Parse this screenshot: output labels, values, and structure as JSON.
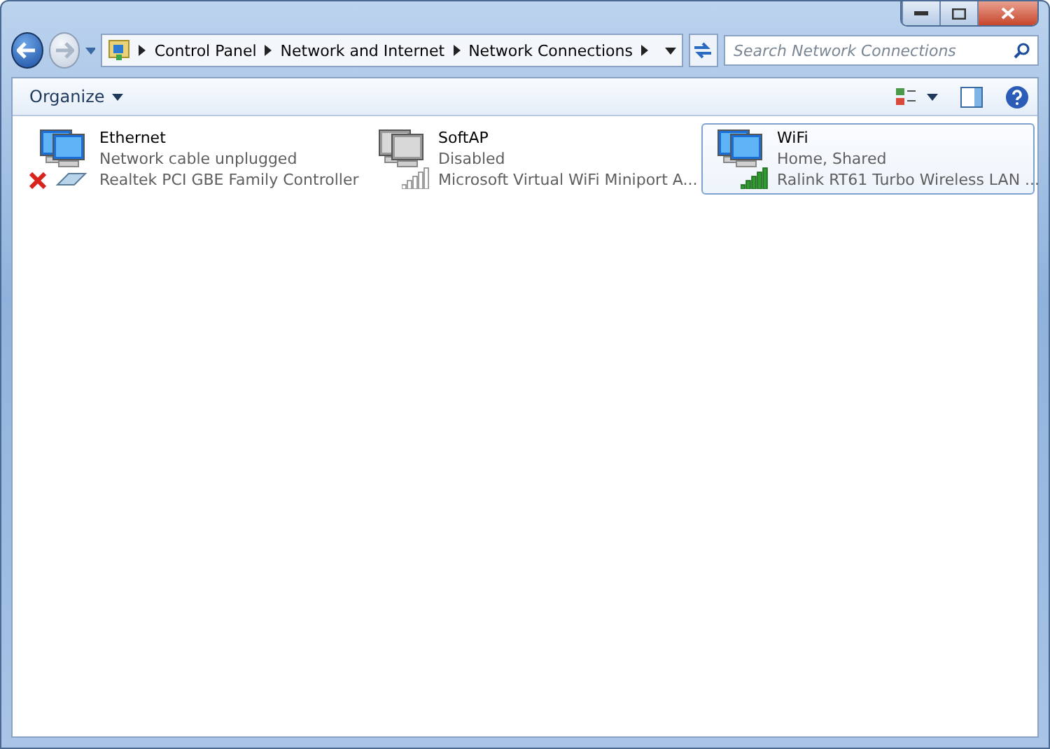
{
  "address_bar": {
    "crumbs": [
      "Control Panel",
      "Network and Internet",
      "Network Connections"
    ]
  },
  "search": {
    "placeholder": "Search Network Connections"
  },
  "toolbar": {
    "organize": "Organize"
  },
  "connections": [
    {
      "name": "Ethernet",
      "status": "Network cable unplugged",
      "device": "Realtek PCI GBE Family Controller",
      "kind": "wired",
      "enabled": true,
      "selected": false
    },
    {
      "name": "SoftAP",
      "status": "Disabled",
      "device": "Microsoft Virtual WiFi Miniport A...",
      "kind": "wireless",
      "enabled": false,
      "selected": false
    },
    {
      "name": "WiFi",
      "status": "Home, Shared",
      "device": "Ralink RT61 Turbo Wireless LAN ...",
      "kind": "wireless",
      "enabled": true,
      "selected": true
    }
  ]
}
